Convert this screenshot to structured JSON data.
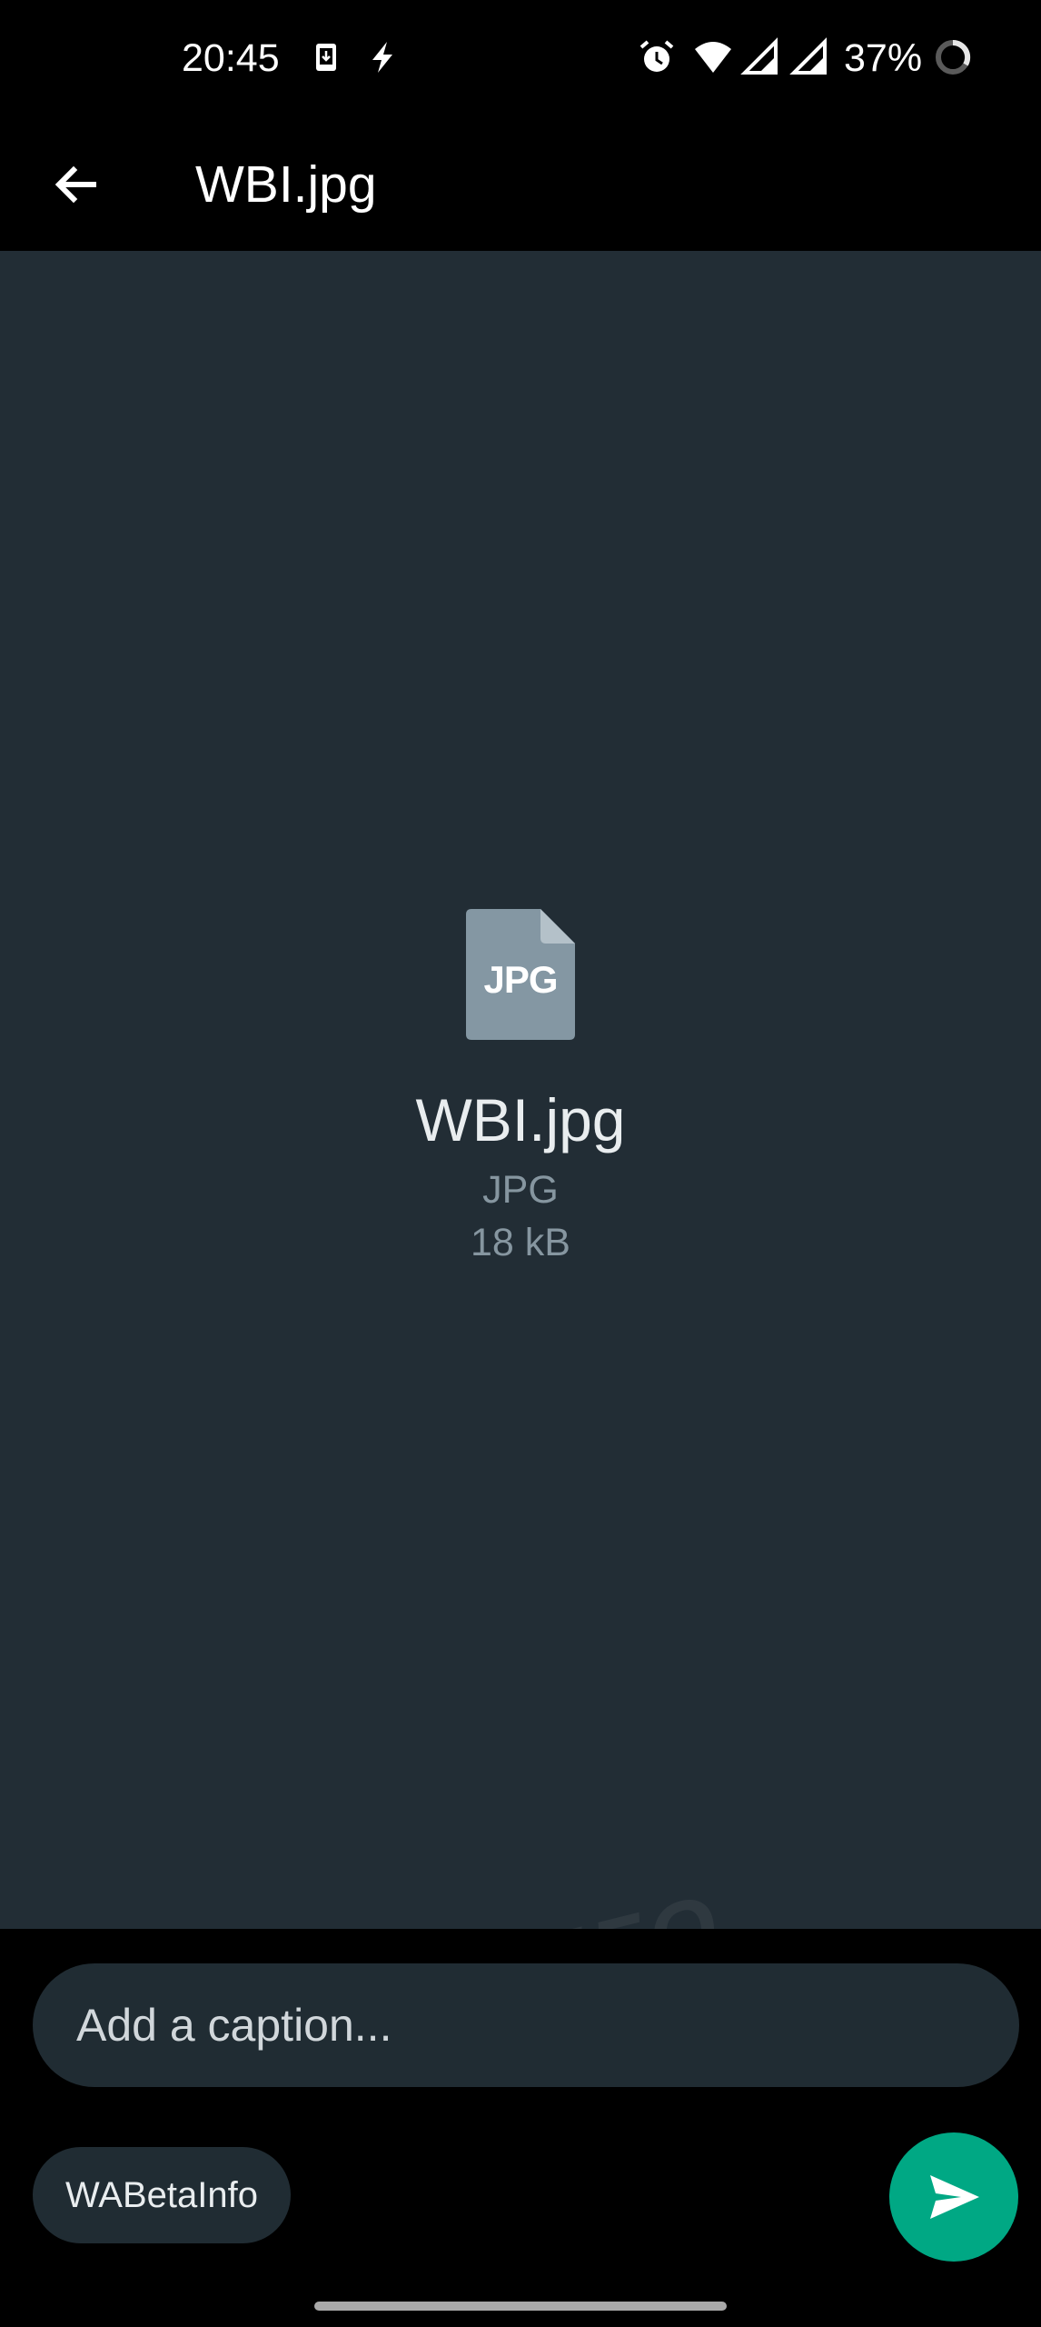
{
  "status_bar": {
    "time": "20:45",
    "battery_percent": "37%",
    "icons": [
      "download-notification-icon",
      "flash-icon",
      "alarm-icon",
      "wifi-icon",
      "signal-icon",
      "signal-icon",
      "battery-ring-icon"
    ]
  },
  "app_bar": {
    "title": "WBI.jpg",
    "back_icon": "arrow-left-icon"
  },
  "preview": {
    "file_icon_label": "JPG",
    "file_name": "WBI.jpg",
    "file_type": "JPG",
    "file_size": "18 kB"
  },
  "composer": {
    "caption_placeholder": "Add a caption...",
    "recipient_label": "WABetaInfo",
    "send_icon": "send-icon"
  },
  "watermark": {
    "text": "CWABETAINFO"
  },
  "colors": {
    "preview_background": "#222d35",
    "input_background": "#202c33",
    "accent_green": "#00a884",
    "secondary_text": "#8696a0",
    "file_icon": "#8497a3"
  }
}
